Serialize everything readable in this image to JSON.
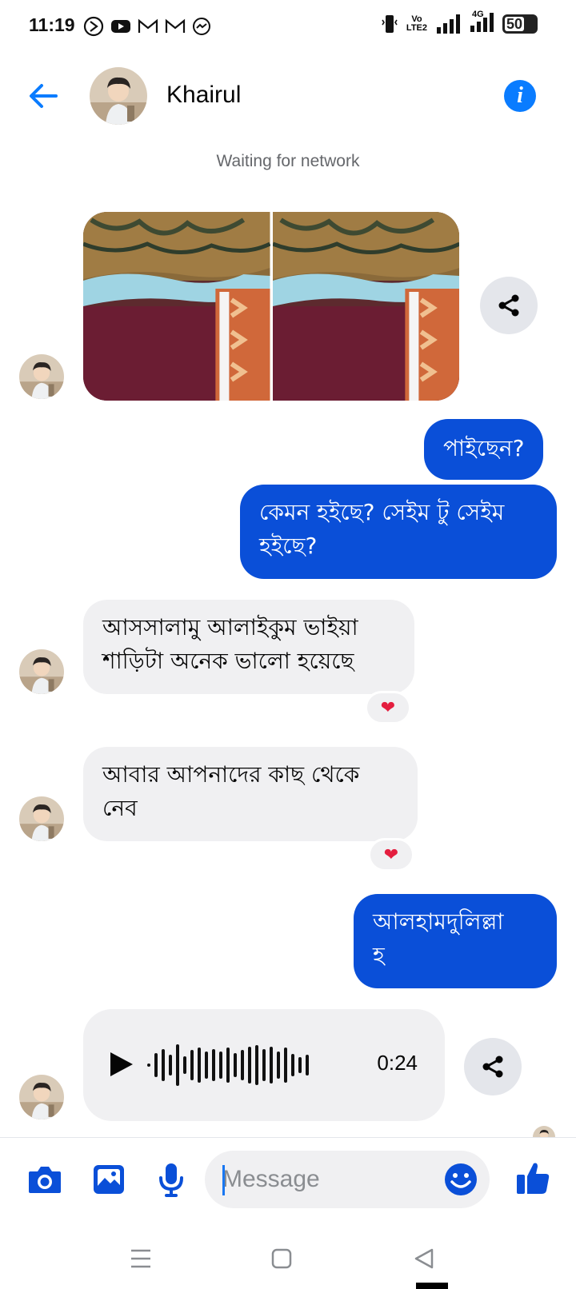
{
  "status_bar": {
    "time": "11:19",
    "volte_top": "Vo",
    "volte_bottom": "LTE2",
    "network": "4G",
    "battery": "50"
  },
  "header": {
    "contact_name": "Khairul",
    "network_status": "Waiting for network"
  },
  "messages": [
    {
      "type": "photos",
      "direction": "in",
      "count": 2
    },
    {
      "type": "text",
      "direction": "out",
      "text": "পাইছেন?"
    },
    {
      "type": "text",
      "direction": "out",
      "text": "কেমন হইছে? সেইম টু সেইম হইছে?"
    },
    {
      "type": "text",
      "direction": "in",
      "text": "আসসালামু আলাইকুম ভাইয়া শাড়িটা অনেক ভালো হয়েছে",
      "reaction": "❤"
    },
    {
      "type": "text",
      "direction": "in",
      "text": "আবার আপনাদের কাছ থেকে নেব",
      "reaction": "❤"
    },
    {
      "type": "text",
      "direction": "out",
      "text": "আলহামদুলিল্লাহ"
    },
    {
      "type": "voice",
      "direction": "in",
      "duration": "0:24"
    }
  ],
  "msg": {
    "m1": "পাইছেন?",
    "m2_line1": "কেমন হইছে? সেইম টু সেইম",
    "m2_line2": "হইছে?",
    "m3_line1": "আসসালামু আলাইকুম ভাইয়া",
    "m3_line2": "শাড়িটা অনেক ভালো হয়েছে",
    "m4_line1": "আবার আপনাদের কাছ থেকে",
    "m4_line2": "নেব",
    "m5_line1": "আলহামদুলিল্লা",
    "m5_line2": "হ",
    "voice_duration": "0:24",
    "reaction": "❤"
  },
  "composer": {
    "placeholder": "Message"
  },
  "icons": {
    "back": "back-arrow-icon",
    "info": "info-icon",
    "share": "share-icon",
    "camera": "camera-icon",
    "gallery": "gallery-icon",
    "mic": "microphone-icon",
    "emoji": "emoji-icon",
    "like": "thumbs-up-icon"
  },
  "colors": {
    "accent": "#0a7cff",
    "outgoing_bubble": "#0a4fd8",
    "incoming_bubble": "#f0f0f2",
    "reaction": "#e41e3f"
  }
}
